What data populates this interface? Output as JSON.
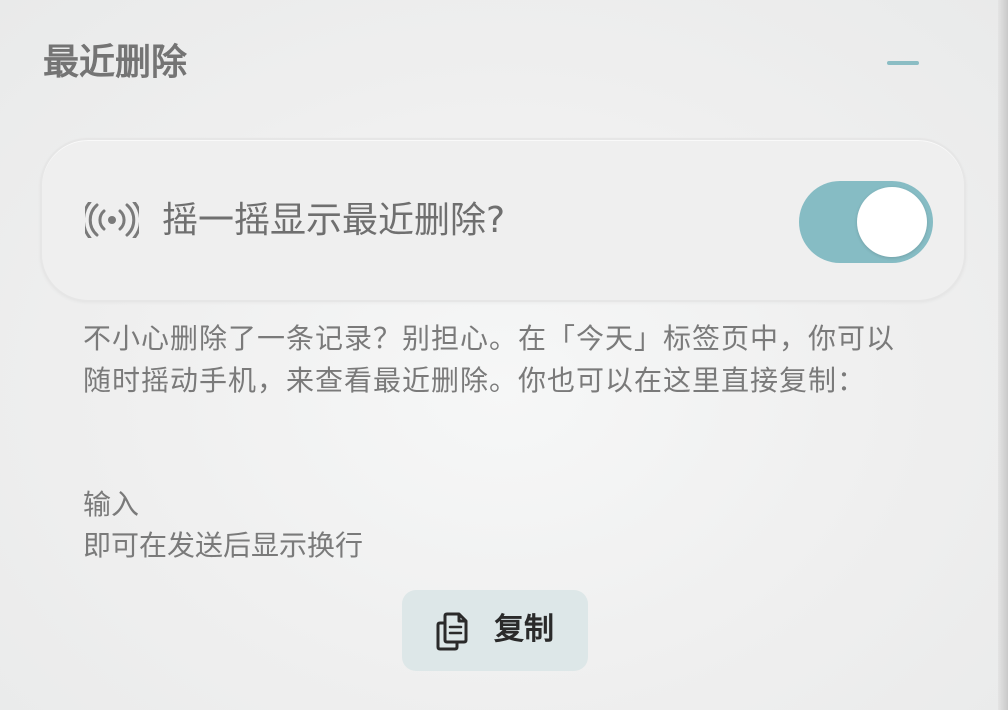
{
  "section": {
    "title": "最近删除",
    "collapse_icon": "minus-icon"
  },
  "shake_setting": {
    "icon": "signal-waves-icon",
    "label": "摇一摇显示最近删除?",
    "enabled": true,
    "accent_color": "#86bcc4"
  },
  "description": "不小心删除了一条记录？别担心。在「今天」标签页中，你可以随时摇动手机，来查看最近删除。你也可以在这里直接复制：",
  "recent_deleted_preview": {
    "lines": [
      "输入",
      "即可在发送后显示换行"
    ]
  },
  "copy_button": {
    "icon": "copy-icon",
    "label": "复制"
  }
}
